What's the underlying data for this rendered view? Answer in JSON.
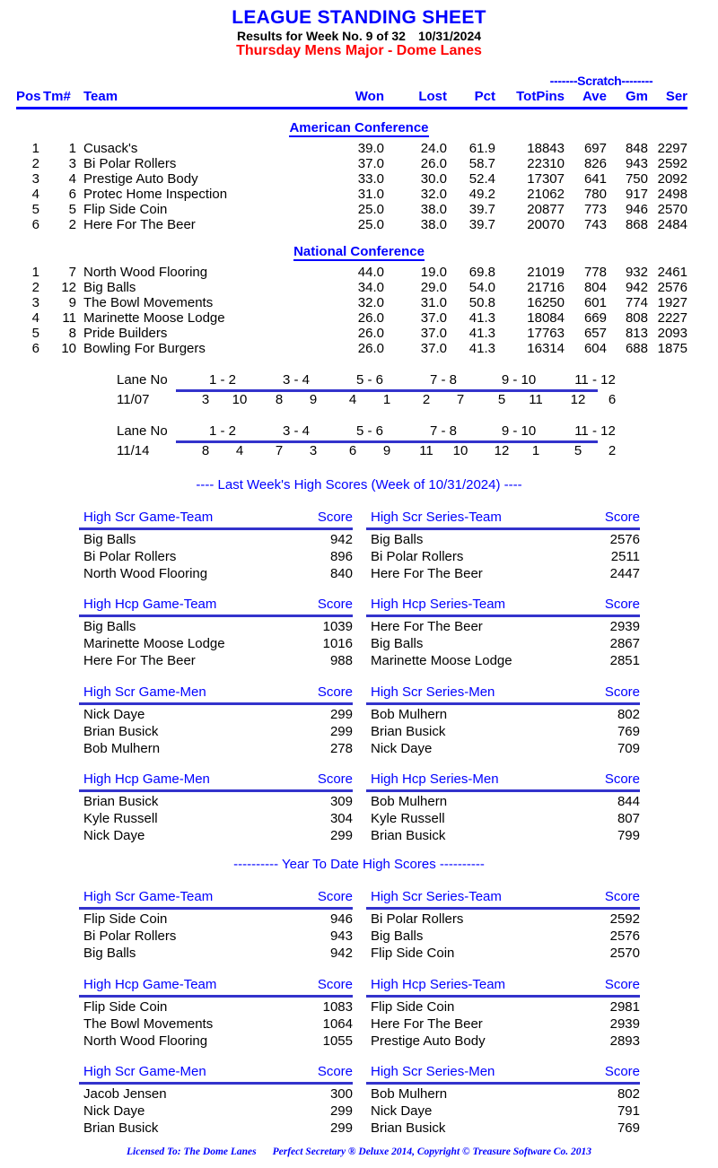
{
  "header": {
    "title": "LEAGUE STANDING SHEET",
    "results_line_prefix": "Results for Week No. 9 of 32",
    "results_date": "10/31/2024",
    "league_name": "Thursday Mens Major - Dome Lanes"
  },
  "standings": {
    "scratch_label": "-------Scratch--------",
    "columns": {
      "pos": "Pos",
      "tm": "Tm#",
      "team": "Team",
      "won": "Won",
      "lost": "Lost",
      "pct": "Pct",
      "totpins": "TotPins",
      "ave": "Ave",
      "gm": "Gm",
      "ser": "Ser"
    },
    "conferences": [
      {
        "name": "American Conference",
        "rows": [
          {
            "pos": "1",
            "tm": "1",
            "team": "Cusack's",
            "won": "39.0",
            "lost": "24.0",
            "pct": "61.9",
            "totpins": "18843",
            "ave": "697",
            "gm": "848",
            "ser": "2297"
          },
          {
            "pos": "2",
            "tm": "3",
            "team": "Bi Polar Rollers",
            "won": "37.0",
            "lost": "26.0",
            "pct": "58.7",
            "totpins": "22310",
            "ave": "826",
            "gm": "943",
            "ser": "2592"
          },
          {
            "pos": "3",
            "tm": "4",
            "team": "Prestige Auto Body",
            "won": "33.0",
            "lost": "30.0",
            "pct": "52.4",
            "totpins": "17307",
            "ave": "641",
            "gm": "750",
            "ser": "2092"
          },
          {
            "pos": "4",
            "tm": "6",
            "team": "Protec Home Inspection",
            "won": "31.0",
            "lost": "32.0",
            "pct": "49.2",
            "totpins": "21062",
            "ave": "780",
            "gm": "917",
            "ser": "2498"
          },
          {
            "pos": "5",
            "tm": "5",
            "team": "Flip Side Coin",
            "won": "25.0",
            "lost": "38.0",
            "pct": "39.7",
            "totpins": "20877",
            "ave": "773",
            "gm": "946",
            "ser": "2570"
          },
          {
            "pos": "6",
            "tm": "2",
            "team": "Here For The Beer",
            "won": "25.0",
            "lost": "38.0",
            "pct": "39.7",
            "totpins": "20070",
            "ave": "743",
            "gm": "868",
            "ser": "2484"
          }
        ]
      },
      {
        "name": "National Conference",
        "rows": [
          {
            "pos": "1",
            "tm": "7",
            "team": "North Wood Flooring",
            "won": "44.0",
            "lost": "19.0",
            "pct": "69.8",
            "totpins": "21019",
            "ave": "778",
            "gm": "932",
            "ser": "2461"
          },
          {
            "pos": "2",
            "tm": "12",
            "team": "Big Balls",
            "won": "34.0",
            "lost": "29.0",
            "pct": "54.0",
            "totpins": "21716",
            "ave": "804",
            "gm": "942",
            "ser": "2576"
          },
          {
            "pos": "3",
            "tm": "9",
            "team": "The Bowl Movements",
            "won": "32.0",
            "lost": "31.0",
            "pct": "50.8",
            "totpins": "16250",
            "ave": "601",
            "gm": "774",
            "ser": "1927"
          },
          {
            "pos": "4",
            "tm": "11",
            "team": "Marinette Moose Lodge",
            "won": "26.0",
            "lost": "37.0",
            "pct": "41.3",
            "totpins": "18084",
            "ave": "669",
            "gm": "808",
            "ser": "2227"
          },
          {
            "pos": "5",
            "tm": "8",
            "team": "Pride Builders",
            "won": "26.0",
            "lost": "37.0",
            "pct": "41.3",
            "totpins": "17763",
            "ave": "657",
            "gm": "813",
            "ser": "2093"
          },
          {
            "pos": "6",
            "tm": "10",
            "team": "Bowling For Burgers",
            "won": "26.0",
            "lost": "37.0",
            "pct": "41.3",
            "totpins": "16314",
            "ave": "604",
            "gm": "688",
            "ser": "1875"
          }
        ]
      }
    ]
  },
  "lane_schedules": [
    {
      "label": "Lane No",
      "date": "11/07",
      "pairs": [
        "1 - 2",
        "3 - 4",
        "5 - 6",
        "7 - 8",
        "9 - 10",
        "11 - 12"
      ],
      "matchups": [
        [
          "3",
          "10"
        ],
        [
          "8",
          "9"
        ],
        [
          "4",
          "1"
        ],
        [
          "2",
          "7"
        ],
        [
          "5",
          "11"
        ],
        [
          "12",
          "6"
        ]
      ]
    },
    {
      "label": "Lane No",
      "date": "11/14",
      "pairs": [
        "1 - 2",
        "3 - 4",
        "5 - 6",
        "7 - 8",
        "9 - 10",
        "11 - 12"
      ],
      "matchups": [
        [
          "8",
          "4"
        ],
        [
          "7",
          "3"
        ],
        [
          "6",
          "9"
        ],
        [
          "11",
          "10"
        ],
        [
          "12",
          "1"
        ],
        [
          "5",
          "2"
        ]
      ]
    }
  ],
  "last_week": {
    "banner": "----  Last Week's High Scores   (Week of 10/31/2024)  ----",
    "score_header": "Score",
    "tables": [
      {
        "left": {
          "title": "High Scr Game-Team",
          "rows": [
            {
              "name": "Big Balls",
              "score": "942"
            },
            {
              "name": "Bi Polar Rollers",
              "score": "896"
            },
            {
              "name": "North Wood Flooring",
              "score": "840"
            }
          ]
        },
        "right": {
          "title": "High Scr Series-Team",
          "rows": [
            {
              "name": "Big Balls",
              "score": "2576"
            },
            {
              "name": "Bi Polar Rollers",
              "score": "2511"
            },
            {
              "name": "Here For The Beer",
              "score": "2447"
            }
          ]
        }
      },
      {
        "left": {
          "title": "High Hcp Game-Team",
          "rows": [
            {
              "name": "Big Balls",
              "score": "1039"
            },
            {
              "name": "Marinette Moose Lodge",
              "score": "1016"
            },
            {
              "name": "Here For The Beer",
              "score": "988"
            }
          ]
        },
        "right": {
          "title": "High Hcp Series-Team",
          "rows": [
            {
              "name": "Here For The Beer",
              "score": "2939"
            },
            {
              "name": "Big Balls",
              "score": "2867"
            },
            {
              "name": "Marinette Moose Lodge",
              "score": "2851"
            }
          ]
        }
      },
      {
        "left": {
          "title": "High Scr Game-Men",
          "rows": [
            {
              "name": "Nick Daye",
              "score": "299"
            },
            {
              "name": "Brian Busick",
              "score": "299"
            },
            {
              "name": "Bob Mulhern",
              "score": "278"
            }
          ]
        },
        "right": {
          "title": "High Scr Series-Men",
          "rows": [
            {
              "name": "Bob Mulhern",
              "score": "802"
            },
            {
              "name": "Brian Busick",
              "score": "769"
            },
            {
              "name": "Nick Daye",
              "score": "709"
            }
          ]
        }
      },
      {
        "left": {
          "title": "High Hcp Game-Men",
          "rows": [
            {
              "name": "Brian Busick",
              "score": "309"
            },
            {
              "name": "Kyle Russell",
              "score": "304"
            },
            {
              "name": "Nick Daye",
              "score": "299"
            }
          ]
        },
        "right": {
          "title": "High Hcp Series-Men",
          "rows": [
            {
              "name": "Bob Mulhern",
              "score": "844"
            },
            {
              "name": "Kyle Russell",
              "score": "807"
            },
            {
              "name": "Brian Busick",
              "score": "799"
            }
          ]
        }
      }
    ]
  },
  "year_to_date": {
    "banner": "---------- Year To Date High Scores ----------",
    "score_header": "Score",
    "tables": [
      {
        "left": {
          "title": "High Scr Game-Team",
          "rows": [
            {
              "name": "Flip Side Coin",
              "score": "946"
            },
            {
              "name": "Bi Polar Rollers",
              "score": "943"
            },
            {
              "name": "Big Balls",
              "score": "942"
            }
          ]
        },
        "right": {
          "title": "High Scr Series-Team",
          "rows": [
            {
              "name": "Bi Polar Rollers",
              "score": "2592"
            },
            {
              "name": "Big Balls",
              "score": "2576"
            },
            {
              "name": "Flip Side Coin",
              "score": "2570"
            }
          ]
        }
      },
      {
        "left": {
          "title": "High Hcp Game-Team",
          "rows": [
            {
              "name": "Flip Side Coin",
              "score": "1083"
            },
            {
              "name": "The Bowl Movements",
              "score": "1064"
            },
            {
              "name": "North Wood Flooring",
              "score": "1055"
            }
          ]
        },
        "right": {
          "title": "High Hcp Series-Team",
          "rows": [
            {
              "name": "Flip Side Coin",
              "score": "2981"
            },
            {
              "name": "Here For The Beer",
              "score": "2939"
            },
            {
              "name": "Prestige Auto Body",
              "score": "2893"
            }
          ]
        }
      },
      {
        "left": {
          "title": "High Scr Game-Men",
          "rows": [
            {
              "name": "Jacob Jensen",
              "score": "300"
            },
            {
              "name": "Nick Daye",
              "score": "299"
            },
            {
              "name": "Brian Busick",
              "score": "299"
            }
          ]
        },
        "right": {
          "title": "High Scr Series-Men",
          "rows": [
            {
              "name": "Bob Mulhern",
              "score": "802"
            },
            {
              "name": "Nick Daye",
              "score": "791"
            },
            {
              "name": "Brian Busick",
              "score": "769"
            }
          ]
        }
      }
    ]
  },
  "footer": {
    "licensed_to": "Licensed To: The Dome Lanes",
    "copyright": "Perfect Secretary ® Deluxe  2014, Copyright © Treasure Software Co. 2013"
  }
}
